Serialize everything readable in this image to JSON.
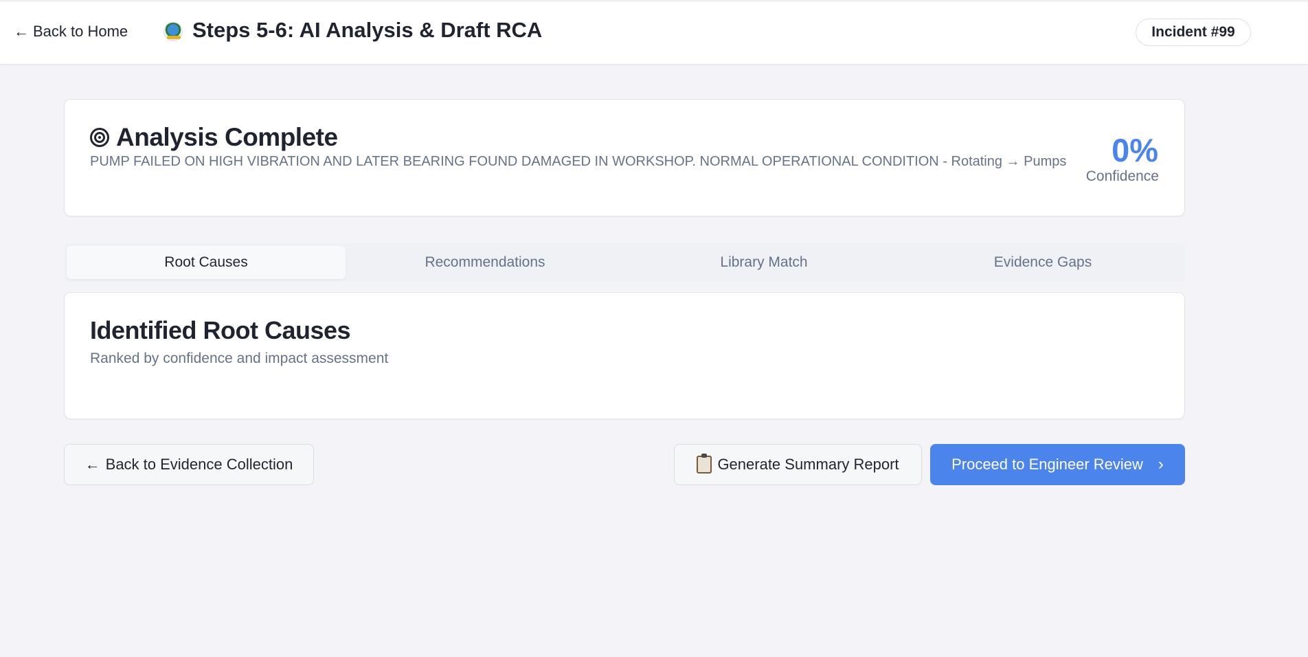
{
  "header": {
    "back_label": "Back to Home",
    "title": "Steps 5-6: AI Analysis & Draft RCA",
    "incident_badge": "Incident #99"
  },
  "analysis": {
    "title": "Analysis Complete",
    "description": "PUMP FAILED ON HIGH VIBRATION AND LATER BEARING FOUND DAMAGED IN WORKSHOP. NORMAL OPERATIONAL CONDITION - Rotating → Pumps",
    "confidence_value": "0%",
    "confidence_label": "Confidence"
  },
  "tabs": [
    {
      "label": "Root Causes",
      "active": true
    },
    {
      "label": "Recommendations",
      "active": false
    },
    {
      "label": "Library Match",
      "active": false
    },
    {
      "label": "Evidence Gaps",
      "active": false
    }
  ],
  "root_causes": {
    "title": "Identified Root Causes",
    "subtitle": "Ranked by confidence and impact assessment"
  },
  "actions": {
    "back_label": "Back to Evidence Collection",
    "report_label": "Generate Summary Report",
    "proceed_label": "Proceed to Engineer Review"
  },
  "colors": {
    "accent": "#4b84ea",
    "muted_text": "#66728a",
    "background": "#f4f4f8"
  },
  "icons": [
    "arrow-left-icon",
    "app-logo",
    "target-icon",
    "clipboard-icon",
    "chevron-right-icon"
  ]
}
